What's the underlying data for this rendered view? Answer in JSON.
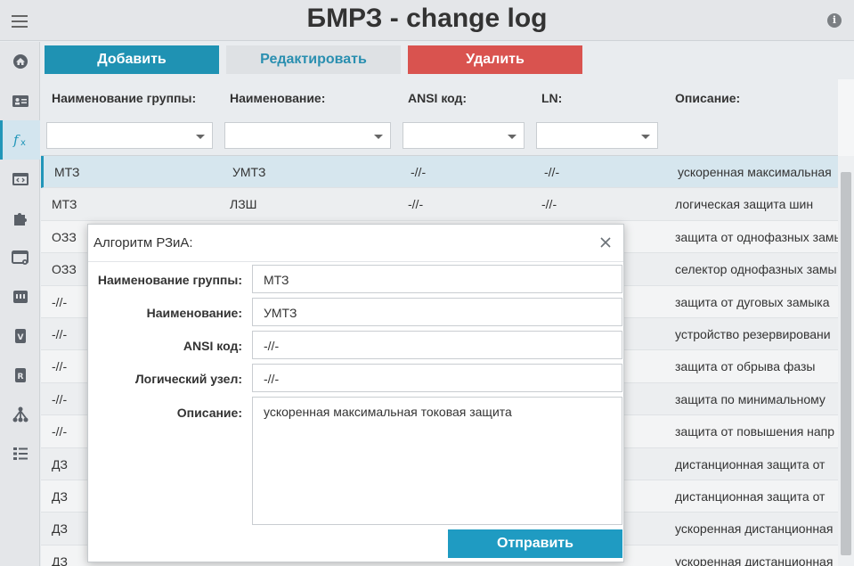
{
  "header": {
    "title": "БМРЗ - change log",
    "info_glyph": "i"
  },
  "sidebar": {
    "items": [
      {
        "icon": "home-icon"
      },
      {
        "icon": "id-card-icon"
      },
      {
        "icon": "function-icon",
        "active": true
      },
      {
        "icon": "code-window-icon"
      },
      {
        "icon": "puzzle-icon"
      },
      {
        "icon": "settings-window-icon"
      },
      {
        "icon": "hardware-icon"
      },
      {
        "icon": "v-badge-icon"
      },
      {
        "icon": "r-badge-icon"
      },
      {
        "icon": "hierarchy-icon"
      },
      {
        "icon": "list-icon"
      }
    ]
  },
  "toolbar": {
    "add_label": "Добавить",
    "edit_label": "Редактировать",
    "delete_label": "Удалить"
  },
  "table": {
    "columns": [
      "Наименование группы:",
      "Наименование:",
      "ANSI код:",
      "LN:",
      "Описание:"
    ],
    "rows": [
      {
        "group": "МТЗ",
        "name": "УМТЗ",
        "ansi": "-//-",
        "ln": "-//-",
        "desc": "ускоренная максимальная"
      },
      {
        "group": "МТЗ",
        "name": "ЛЗШ",
        "ansi": "-//-",
        "ln": "-//-",
        "desc": "логическая защита шин"
      },
      {
        "group": "ОЗЗ",
        "name": "",
        "ansi": "",
        "ln": "",
        "desc": "защита от однофазных замы"
      },
      {
        "group": "ОЗЗ",
        "name": "",
        "ansi": "",
        "ln": "",
        "desc": "селектор однофазных замы"
      },
      {
        "group": "-//-",
        "name": "",
        "ansi": "",
        "ln": "",
        "desc": "защита от дуговых замыка"
      },
      {
        "group": "-//-",
        "name": "",
        "ansi": "",
        "ln": "",
        "desc": "устройство резервировани"
      },
      {
        "group": "-//-",
        "name": "",
        "ansi": "",
        "ln": "",
        "desc": "защита от обрыва фазы"
      },
      {
        "group": "-//-",
        "name": "",
        "ansi": "",
        "ln": "",
        "desc": "защита по минимальному"
      },
      {
        "group": "-//-",
        "name": "",
        "ansi": "",
        "ln": "",
        "desc": "защита от повышения напр"
      },
      {
        "group": "ДЗ",
        "name": "",
        "ansi": "",
        "ln": "",
        "desc": "дистанционная защита от"
      },
      {
        "group": "ДЗ",
        "name": "",
        "ansi": "",
        "ln": "",
        "desc": "дистанционная защита от"
      },
      {
        "group": "ДЗ",
        "name": "",
        "ansi": "",
        "ln": "",
        "desc": "ускоренная дистанционная"
      },
      {
        "group": "ДЗ",
        "name": "",
        "ansi": "",
        "ln": "",
        "desc": "ускоренная дистанционная"
      }
    ]
  },
  "dialog": {
    "title": "Алгоритм РЗиА:",
    "labels": {
      "group": "Наименование группы:",
      "name": "Наименование:",
      "ansi": "ANSI код:",
      "ln": "Логический узел:",
      "desc": "Описание:"
    },
    "values": {
      "group": "МТЗ",
      "name": "УМТЗ",
      "ansi": "-//-",
      "ln": "-//-",
      "desc": "ускоренная максимальная токовая защита"
    },
    "submit_label": "Отправить"
  },
  "colors": {
    "primary": "#1f92b3",
    "danger": "#d9534f",
    "selected_row": "#d6e6ee"
  }
}
